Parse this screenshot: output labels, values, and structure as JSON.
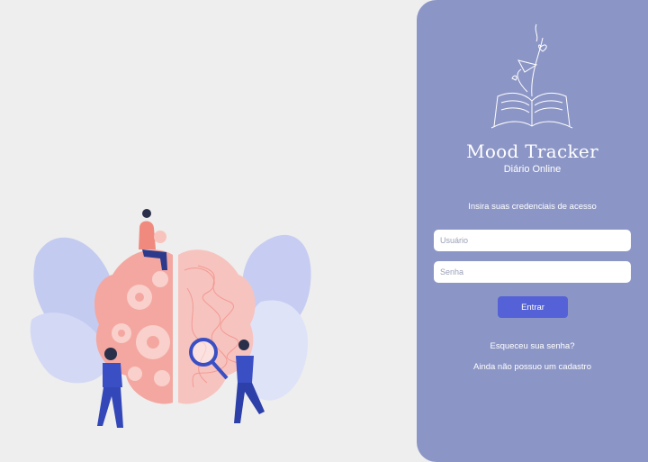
{
  "brand": {
    "title": "Mood Tracker",
    "subtitle": "Diário Online"
  },
  "login": {
    "instructions": "Insira suas credenciais de acesso",
    "username_placeholder": "Usuário",
    "password_placeholder": "Senha",
    "submit_label": "Entrar",
    "forgot_link": "Esqueceu sua senha?",
    "signup_link": "Ainda não possuo um cadastro"
  },
  "colors": {
    "page_background": "#eeeeee",
    "panel_background": "#8c96c6",
    "button": "#5561d6",
    "brain_left": "#f4a7a0",
    "brain_right": "#f7c3bf",
    "people": "#3b4fc4"
  },
  "icons": {
    "logo": "open-book-with-paper-plane-and-flowers",
    "illustration": "brain-with-gears-and-people"
  }
}
